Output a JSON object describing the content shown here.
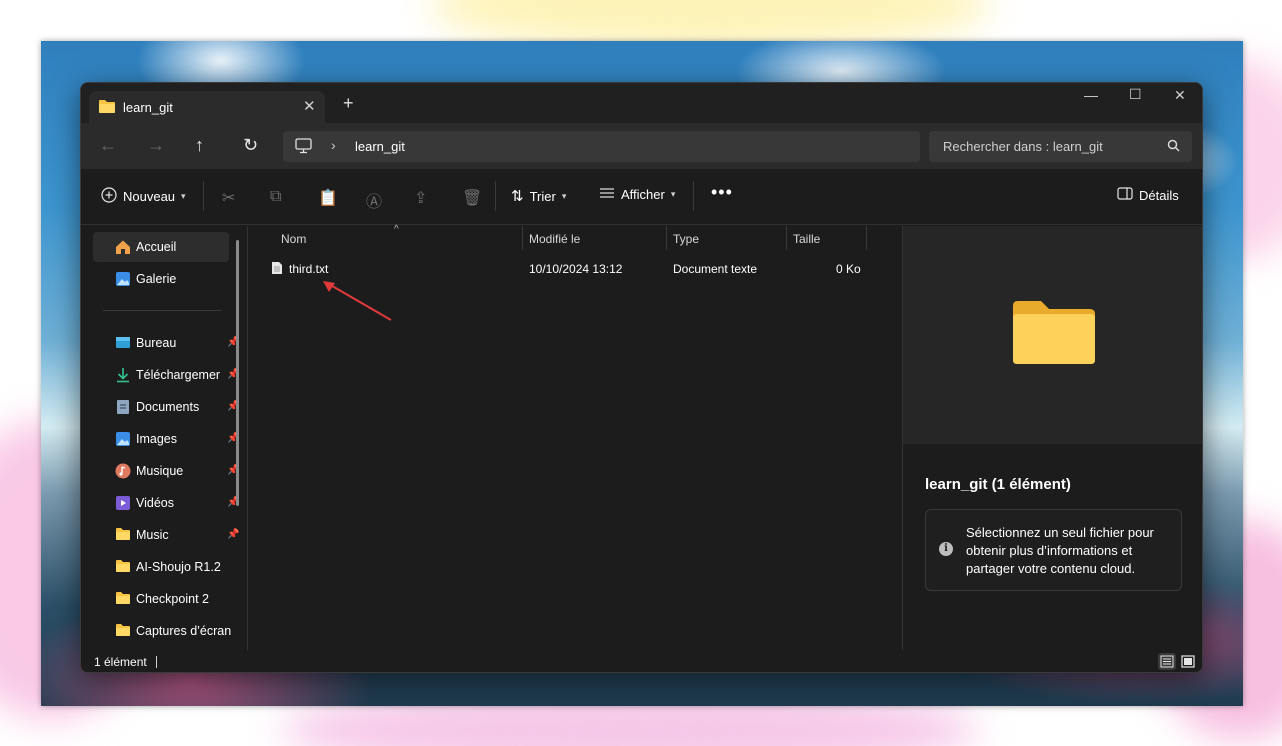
{
  "window": {
    "tab_title": "learn_git",
    "tab_close": "✕",
    "new_tab": "+"
  },
  "controls": {
    "minimize": "—",
    "maximize": "☐",
    "close": "✕"
  },
  "nav": {
    "back": "←",
    "forward": "→",
    "up": "↑",
    "refresh": "↻",
    "breadcrumb_separator": "›",
    "breadcrumb": "learn_git",
    "search_placeholder": "Rechercher dans : learn_git"
  },
  "toolbar": {
    "new_label": "Nouveau",
    "sort_label": "Trier",
    "view_label": "Afficher",
    "more_label": "•••",
    "details_label": "Détails"
  },
  "sidebar": {
    "top_items": [
      {
        "label": "Accueil",
        "icon": "home-icon",
        "active": true
      },
      {
        "label": "Galerie",
        "icon": "gallery-icon",
        "active": false
      }
    ],
    "pinned_items": [
      {
        "label": "Bureau",
        "icon": "desktop-icon"
      },
      {
        "label": "Téléchargemer",
        "icon": "download-icon"
      },
      {
        "label": "Documents",
        "icon": "documents-icon"
      },
      {
        "label": "Images",
        "icon": "images-icon"
      },
      {
        "label": "Musique",
        "icon": "music-icon"
      },
      {
        "label": "Vidéos",
        "icon": "videos-icon"
      },
      {
        "label": "Music",
        "icon": "folder-icon"
      }
    ],
    "folders": [
      {
        "label": "AI-Shoujo R1.2",
        "icon": "folder-icon"
      },
      {
        "label": "Checkpoint 2",
        "icon": "folder-icon"
      },
      {
        "label": "Captures d’écran",
        "icon": "folder-icon"
      }
    ],
    "pin_glyph": "📌"
  },
  "file_list": {
    "columns": [
      "Nom",
      "Modifié le",
      "Type",
      "Taille"
    ],
    "sort_indicator": "^",
    "rows": [
      {
        "name": "third.txt",
        "modified": "10/10/2024 13:12",
        "type": "Document texte",
        "size": "0 Ko"
      }
    ]
  },
  "details": {
    "title": "learn_git (1 élément)",
    "info_glyph": "i",
    "info": "Sélectionnez un seul fichier pour obtenir plus d’informations et partager votre contenu cloud."
  },
  "status": {
    "count": "1 élément"
  },
  "colors": {
    "accent_arrow": "#e03a3a",
    "folder": "#f5c542",
    "window_bg": "#1c1c1c"
  }
}
